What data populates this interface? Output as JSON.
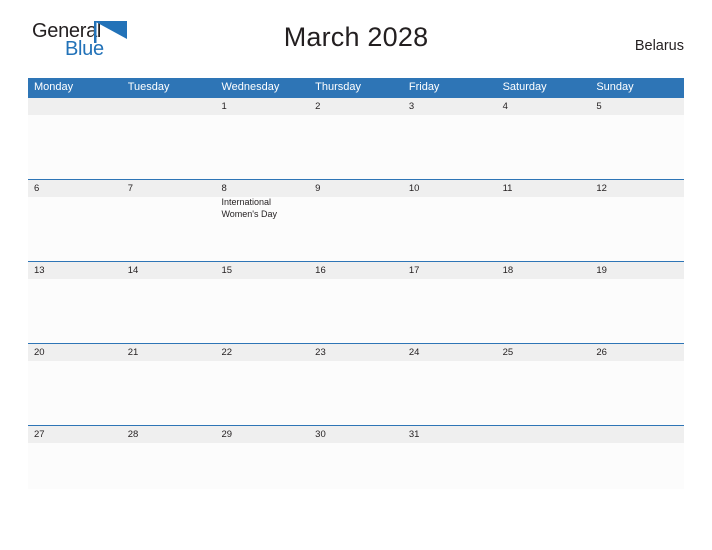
{
  "brand": {
    "name_top": "General",
    "name_bottom": "Blue",
    "flag_icon": "flag-triangle-icon",
    "top_color": "#231f20",
    "bottom_color": "#2272b8"
  },
  "header": {
    "title": "March 2028",
    "country": "Belarus"
  },
  "theme": {
    "header_blue": "#2e75b6",
    "band_gray": "#efefef",
    "cell_white": "#fcfcfc",
    "text_dark": "#231f20"
  },
  "calendar": {
    "weekdays": [
      "Monday",
      "Tuesday",
      "Wednesday",
      "Thursday",
      "Friday",
      "Saturday",
      "Sunday"
    ],
    "weeks": [
      {
        "days": [
          {
            "number": "",
            "events": []
          },
          {
            "number": "",
            "events": []
          },
          {
            "number": "1",
            "events": []
          },
          {
            "number": "2",
            "events": []
          },
          {
            "number": "3",
            "events": []
          },
          {
            "number": "4",
            "events": []
          },
          {
            "number": "5",
            "events": []
          }
        ]
      },
      {
        "days": [
          {
            "number": "6",
            "events": []
          },
          {
            "number": "7",
            "events": []
          },
          {
            "number": "8",
            "events": [
              "International",
              "Women's Day"
            ]
          },
          {
            "number": "9",
            "events": []
          },
          {
            "number": "10",
            "events": []
          },
          {
            "number": "11",
            "events": []
          },
          {
            "number": "12",
            "events": []
          }
        ]
      },
      {
        "days": [
          {
            "number": "13",
            "events": []
          },
          {
            "number": "14",
            "events": []
          },
          {
            "number": "15",
            "events": []
          },
          {
            "number": "16",
            "events": []
          },
          {
            "number": "17",
            "events": []
          },
          {
            "number": "18",
            "events": []
          },
          {
            "number": "19",
            "events": []
          }
        ]
      },
      {
        "days": [
          {
            "number": "20",
            "events": []
          },
          {
            "number": "21",
            "events": []
          },
          {
            "number": "22",
            "events": []
          },
          {
            "number": "23",
            "events": []
          },
          {
            "number": "24",
            "events": []
          },
          {
            "number": "25",
            "events": []
          },
          {
            "number": "26",
            "events": []
          }
        ]
      },
      {
        "days": [
          {
            "number": "27",
            "events": []
          },
          {
            "number": "28",
            "events": []
          },
          {
            "number": "29",
            "events": []
          },
          {
            "number": "30",
            "events": []
          },
          {
            "number": "31",
            "events": []
          },
          {
            "number": "",
            "events": []
          },
          {
            "number": "",
            "events": []
          }
        ]
      }
    ]
  }
}
